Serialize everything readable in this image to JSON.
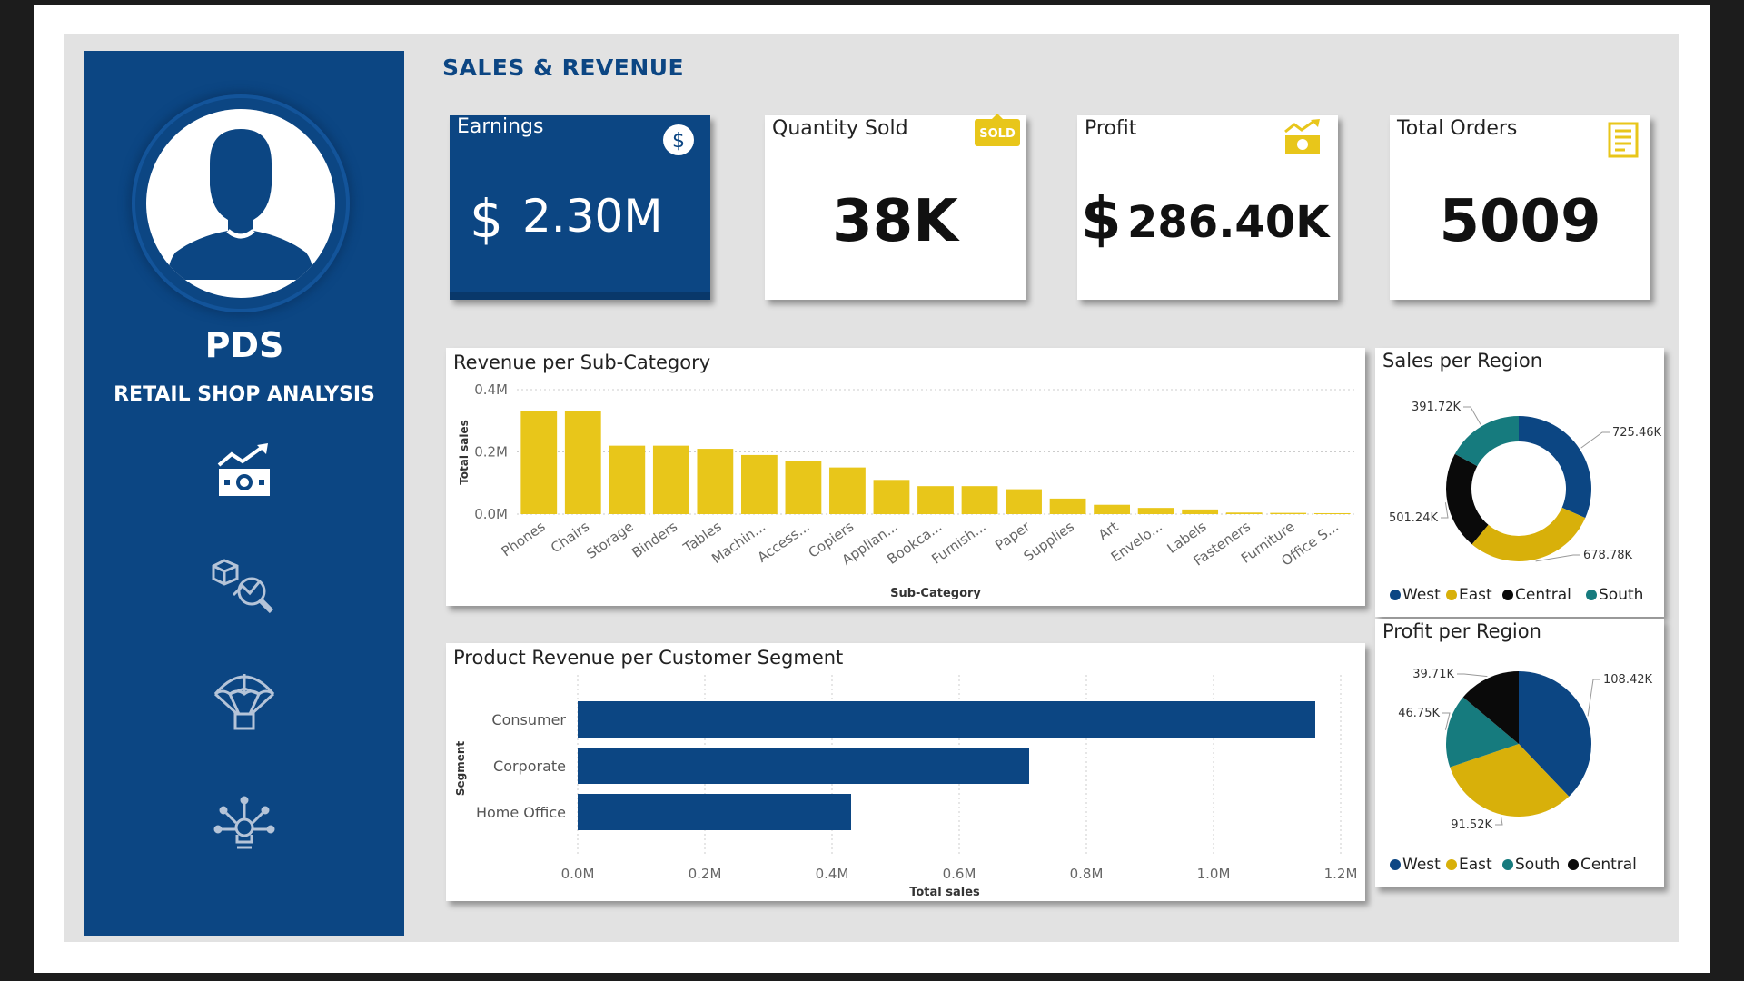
{
  "sidebar": {
    "brand_title": "PDS",
    "brand_subtitle": "RETAIL SHOP ANALYSIS",
    "nav_icons": [
      "money-growth-icon",
      "product-analytics-icon",
      "parachute-delivery-icon",
      "idea-network-icon"
    ]
  },
  "header": {
    "title": "SALES & REVENUE"
  },
  "kpis": {
    "earnings": {
      "label": "Earnings",
      "currency": "$",
      "value": "2.30M"
    },
    "quantity": {
      "label": "Quantity Sold",
      "value": "38K",
      "badge": "SOLD"
    },
    "profit": {
      "label": "Profit",
      "currency": "$",
      "value": "286.40K"
    },
    "orders": {
      "label": "Total Orders",
      "value": "5009"
    }
  },
  "colors": {
    "navy": "#0c4683",
    "gold": "#e8c61a",
    "gold_dark": "#d8b00a",
    "teal": "#167b7e",
    "black": "#0a0a0a",
    "grid": "#cccccc"
  },
  "chart_data": [
    {
      "type": "bar",
      "title": "Revenue per Sub-Category",
      "xlabel": "Sub-Category",
      "ylabel": "Total sales",
      "ylim": [
        0,
        0.4
      ],
      "yticks": [
        "0.0M",
        "0.2M",
        "0.4M"
      ],
      "categories": [
        "Phones",
        "Chairs",
        "Storage",
        "Binders",
        "Tables",
        "Machin...",
        "Access...",
        "Copiers",
        "Applian...",
        "Bookca...",
        "Furnish...",
        "Paper",
        "Supplies",
        "Art",
        "Envelo...",
        "Labels",
        "Fasteners",
        "Furniture",
        "Office S..."
      ],
      "values": [
        0.33,
        0.33,
        0.22,
        0.22,
        0.21,
        0.19,
        0.17,
        0.15,
        0.11,
        0.09,
        0.09,
        0.08,
        0.05,
        0.03,
        0.02,
        0.015,
        0.005,
        0.004,
        0.003
      ],
      "grid": true
    },
    {
      "type": "bar",
      "orientation": "horizontal",
      "title": "Product Revenue per Customer Segment",
      "xlabel": "Total sales",
      "ylabel": "Segment",
      "xlim": [
        0,
        1.2
      ],
      "xticks": [
        "0.0M",
        "0.2M",
        "0.4M",
        "0.6M",
        "0.8M",
        "1.0M",
        "1.2M"
      ],
      "categories": [
        "Consumer",
        "Corporate",
        "Home Office"
      ],
      "values": [
        1.16,
        0.71,
        0.43
      ],
      "grid": true
    },
    {
      "type": "pie",
      "variant": "donut",
      "title": "Sales per Region",
      "slices": [
        {
          "name": "West",
          "value": 725.46,
          "label": "725.46K"
        },
        {
          "name": "East",
          "value": 678.78,
          "label": "678.78K"
        },
        {
          "name": "Central",
          "value": 501.24,
          "label": "501.24K"
        },
        {
          "name": "South",
          "value": 391.72,
          "label": "391.72K"
        }
      ],
      "legend": [
        "West",
        "East",
        "Central",
        "South"
      ],
      "legend_position": "bottom"
    },
    {
      "type": "pie",
      "title": "Profit per Region",
      "slices": [
        {
          "name": "West",
          "value": 108.42,
          "label": "108.42K"
        },
        {
          "name": "East",
          "value": 91.52,
          "label": "91.52K"
        },
        {
          "name": "South",
          "value": 46.75,
          "label": "46.75K"
        },
        {
          "name": "Central",
          "value": 39.71,
          "label": "39.71K"
        }
      ],
      "legend": [
        "West",
        "East",
        "South",
        "Central"
      ],
      "legend_position": "bottom"
    }
  ]
}
